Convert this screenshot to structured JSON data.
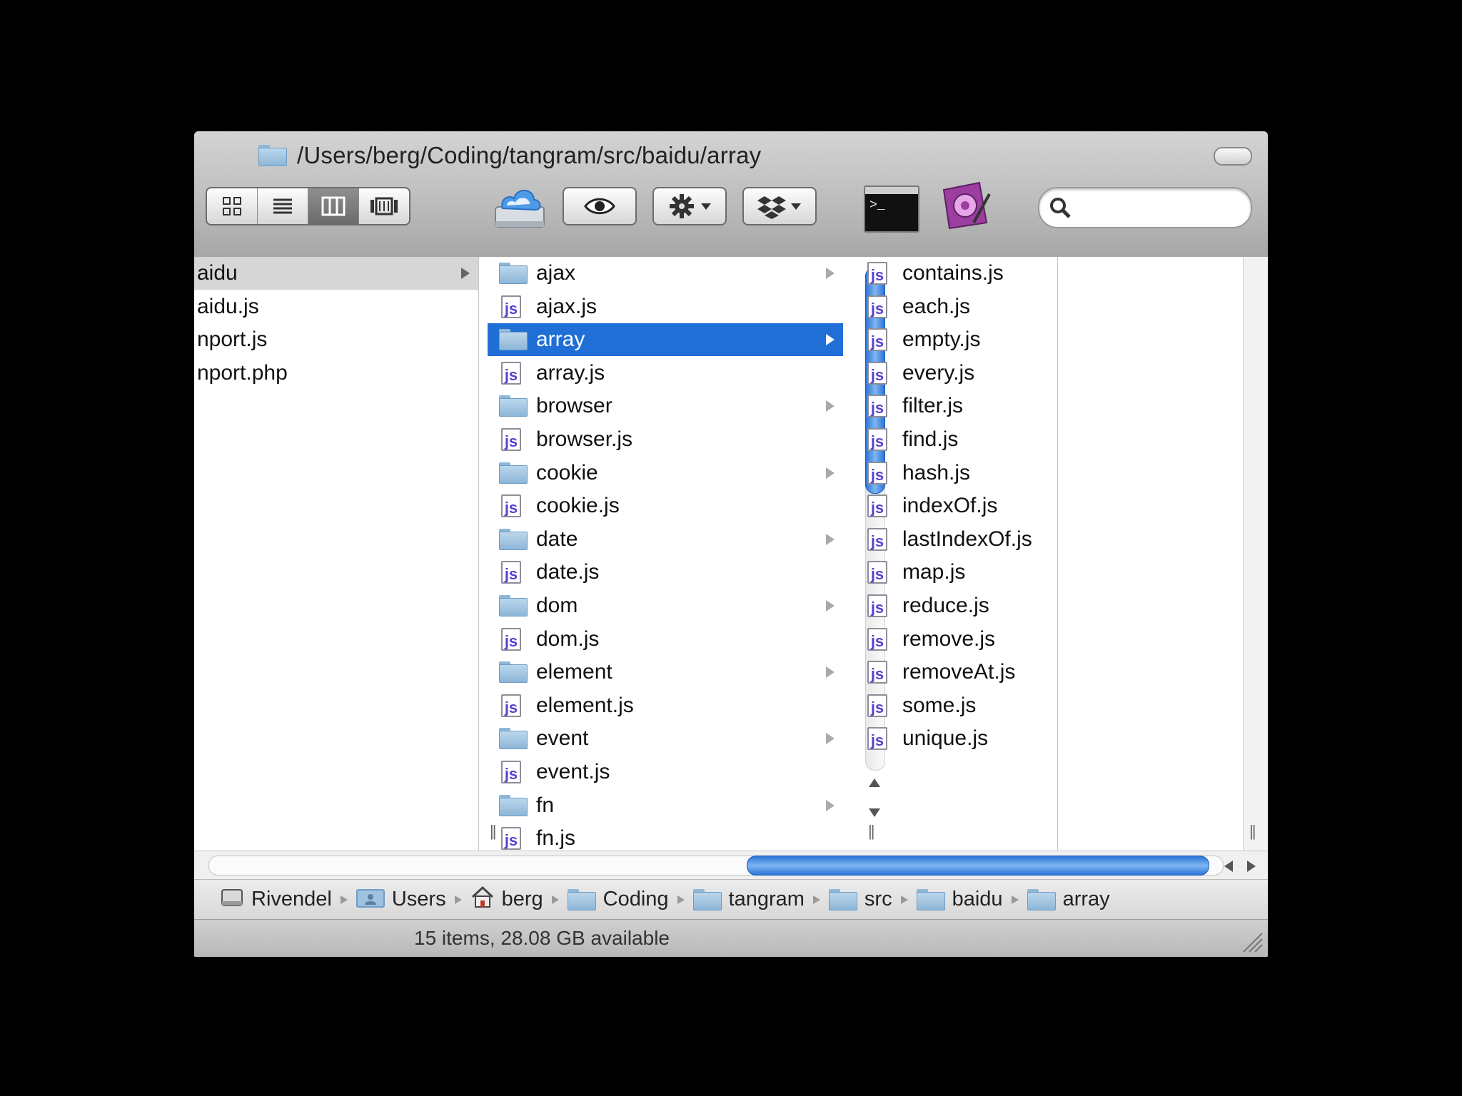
{
  "window": {
    "path_title": "/Users/berg/Coding/tangram/src/baidu/array"
  },
  "toolbar": {
    "view_buttons": [
      "icon-view",
      "list-view",
      "column-view",
      "cover-flow-view"
    ],
    "search": {
      "value": "",
      "placeholder": ""
    }
  },
  "columns": {
    "col1": [
      {
        "label": "aidu",
        "type": "folder"
      },
      {
        "label": "aidu.js",
        "type": "file"
      },
      {
        "label": "nport.js",
        "type": "file"
      },
      {
        "label": "nport.php",
        "type": "file"
      }
    ],
    "col2": [
      {
        "label": "ajax",
        "type": "folder"
      },
      {
        "label": "ajax.js",
        "type": "js"
      },
      {
        "label": "array",
        "type": "folder"
      },
      {
        "label": "array.js",
        "type": "js"
      },
      {
        "label": "browser",
        "type": "folder"
      },
      {
        "label": "browser.js",
        "type": "js"
      },
      {
        "label": "cookie",
        "type": "folder"
      },
      {
        "label": "cookie.js",
        "type": "js"
      },
      {
        "label": "date",
        "type": "folder"
      },
      {
        "label": "date.js",
        "type": "js"
      },
      {
        "label": "dom",
        "type": "folder"
      },
      {
        "label": "dom.js",
        "type": "js"
      },
      {
        "label": "element",
        "type": "folder"
      },
      {
        "label": "element.js",
        "type": "js"
      },
      {
        "label": "event",
        "type": "folder"
      },
      {
        "label": "event.js",
        "type": "js"
      },
      {
        "label": "fn",
        "type": "folder"
      },
      {
        "label": "fn.js",
        "type": "js"
      }
    ],
    "col3": [
      "contains.js",
      "each.js",
      "empty.js",
      "every.js",
      "filter.js",
      "find.js",
      "hash.js",
      "indexOf.js",
      "lastIndexOf.js",
      "map.js",
      "reduce.js",
      "remove.js",
      "removeAt.js",
      "some.js",
      "unique.js"
    ]
  },
  "pathbar": {
    "items": [
      {
        "label": "Rivendel",
        "icon": "hard-drive-icon"
      },
      {
        "label": "Users",
        "icon": "users-folder-icon"
      },
      {
        "label": "berg",
        "icon": "home-icon"
      },
      {
        "label": "Coding",
        "icon": "folder-icon"
      },
      {
        "label": "tangram",
        "icon": "folder-icon"
      },
      {
        "label": "src",
        "icon": "folder-icon"
      },
      {
        "label": "baidu",
        "icon": "folder-icon"
      },
      {
        "label": "array",
        "icon": "folder-icon"
      }
    ]
  },
  "status": {
    "text": "15 items, 28.08 GB available"
  },
  "colors": {
    "selection": "#1f6fd6",
    "js_letters": "#5a3fd0",
    "folder": "#8db6d8"
  }
}
